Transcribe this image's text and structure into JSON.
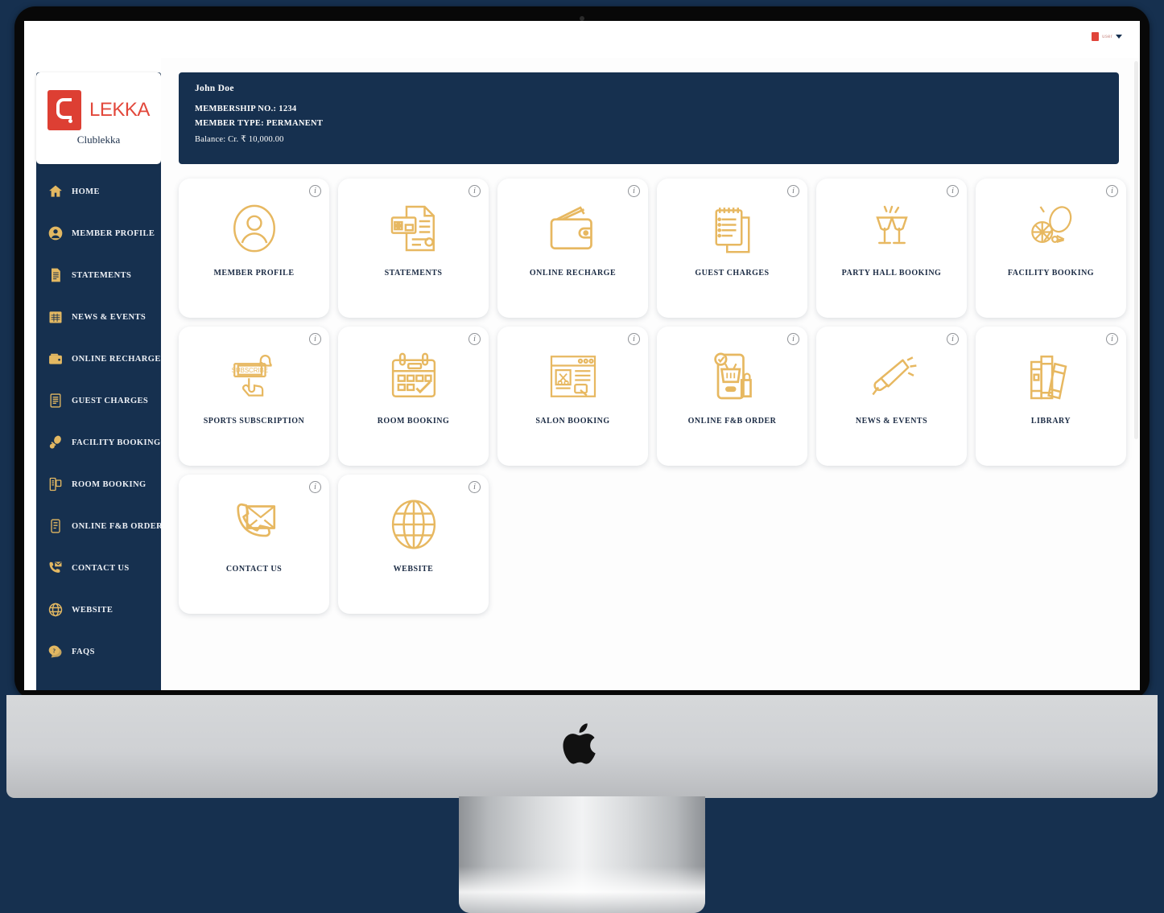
{
  "topbar": {
    "account_label": "user",
    "caret_icon": "chevron-down-icon"
  },
  "sidebar": {
    "brand": {
      "mark_letter": "C.",
      "wordmark": "LEKKA",
      "name": "Clublekka",
      "mark_color": "#dd3f33",
      "word_color": "#e2483b"
    },
    "items": [
      {
        "label": "HOME",
        "icon": "home-icon"
      },
      {
        "label": "MEMBER PROFILE",
        "icon": "user-circle-icon"
      },
      {
        "label": "STATEMENTS",
        "icon": "document-icon"
      },
      {
        "label": "NEWS & EVENTS",
        "icon": "calendar-icon"
      },
      {
        "label": "ONLINE RECHARGE",
        "icon": "wallet-icon"
      },
      {
        "label": "GUEST CHARGES",
        "icon": "invoice-icon"
      },
      {
        "label": "FACILITY BOOKING",
        "icon": "racket-ball-icon"
      },
      {
        "label": "ROOM BOOKING",
        "icon": "room-key-icon"
      },
      {
        "label": "ONLINE F&B ORDER",
        "icon": "mobile-order-icon"
      },
      {
        "label": "CONTACT US",
        "icon": "phone-mail-icon"
      },
      {
        "label": "WEBSITE",
        "icon": "globe-icon"
      },
      {
        "label": "FAQS",
        "icon": "question-bubble-icon"
      }
    ]
  },
  "member": {
    "name": "John Doe",
    "membership_no_line": "MEMBERSHIP NO.: 1234",
    "member_type_line": "MEMBER TYPE: PERMANENT",
    "balance_line": "Balance: Cr. ₹ 10,000.00",
    "banner_color": "#16304f"
  },
  "tiles": {
    "info_glyph": "i",
    "icon_color": "#e7b861",
    "items": [
      {
        "label": "MEMBER PROFILE",
        "icon": "user-circle-icon"
      },
      {
        "label": "STATEMENTS",
        "icon": "statement-document-icon"
      },
      {
        "label": "ONLINE RECHARGE",
        "icon": "wallet-icon"
      },
      {
        "label": "GUEST CHARGES",
        "icon": "notepad-icon"
      },
      {
        "label": "PARTY HALL BOOKING",
        "icon": "cheers-glasses-icon"
      },
      {
        "label": "FACILITY BOOKING",
        "icon": "racket-ball-icon"
      },
      {
        "label": "SPORTS SUBSCRIPTION",
        "icon": "subscribe-button-icon"
      },
      {
        "label": "ROOM BOOKING",
        "icon": "calendar-check-icon"
      },
      {
        "label": "SALON BOOKING",
        "icon": "salon-page-icon"
      },
      {
        "label": "ONLINE F&B ORDER",
        "icon": "mobile-basket-icon"
      },
      {
        "label": "NEWS & EVENTS",
        "icon": "megaphone-icon"
      },
      {
        "label": "LIBRARY",
        "icon": "books-icon"
      },
      {
        "label": "CONTACT US",
        "icon": "phone-envelope-icon"
      },
      {
        "label": "WEBSITE",
        "icon": "globe-icon"
      }
    ]
  }
}
